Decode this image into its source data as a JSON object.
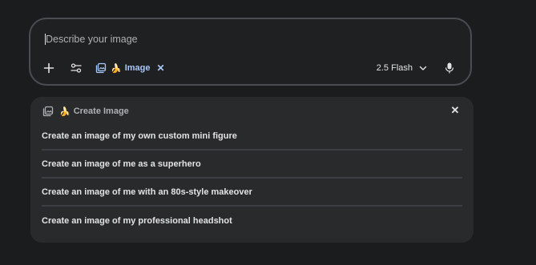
{
  "composer": {
    "placeholder": "Describe your image",
    "value": "",
    "chip": {
      "label": "Image",
      "icon": "image-stack-icon",
      "emoji": "🍌"
    },
    "model": {
      "label": "2.5 Flash"
    }
  },
  "panel": {
    "title": "Create Image",
    "emoji": "🍌",
    "suggestions": [
      "Create an image of my own custom mini figure",
      "Create an image of me as a superhero",
      "Create an image of me with an 80s-style makeover",
      "Create an image of my professional headshot"
    ]
  },
  "colors": {
    "background": "#1b1c1d",
    "composer_border": "#4a4c50",
    "panel_bg": "#282a2c",
    "accent": "#a8c7fa"
  }
}
